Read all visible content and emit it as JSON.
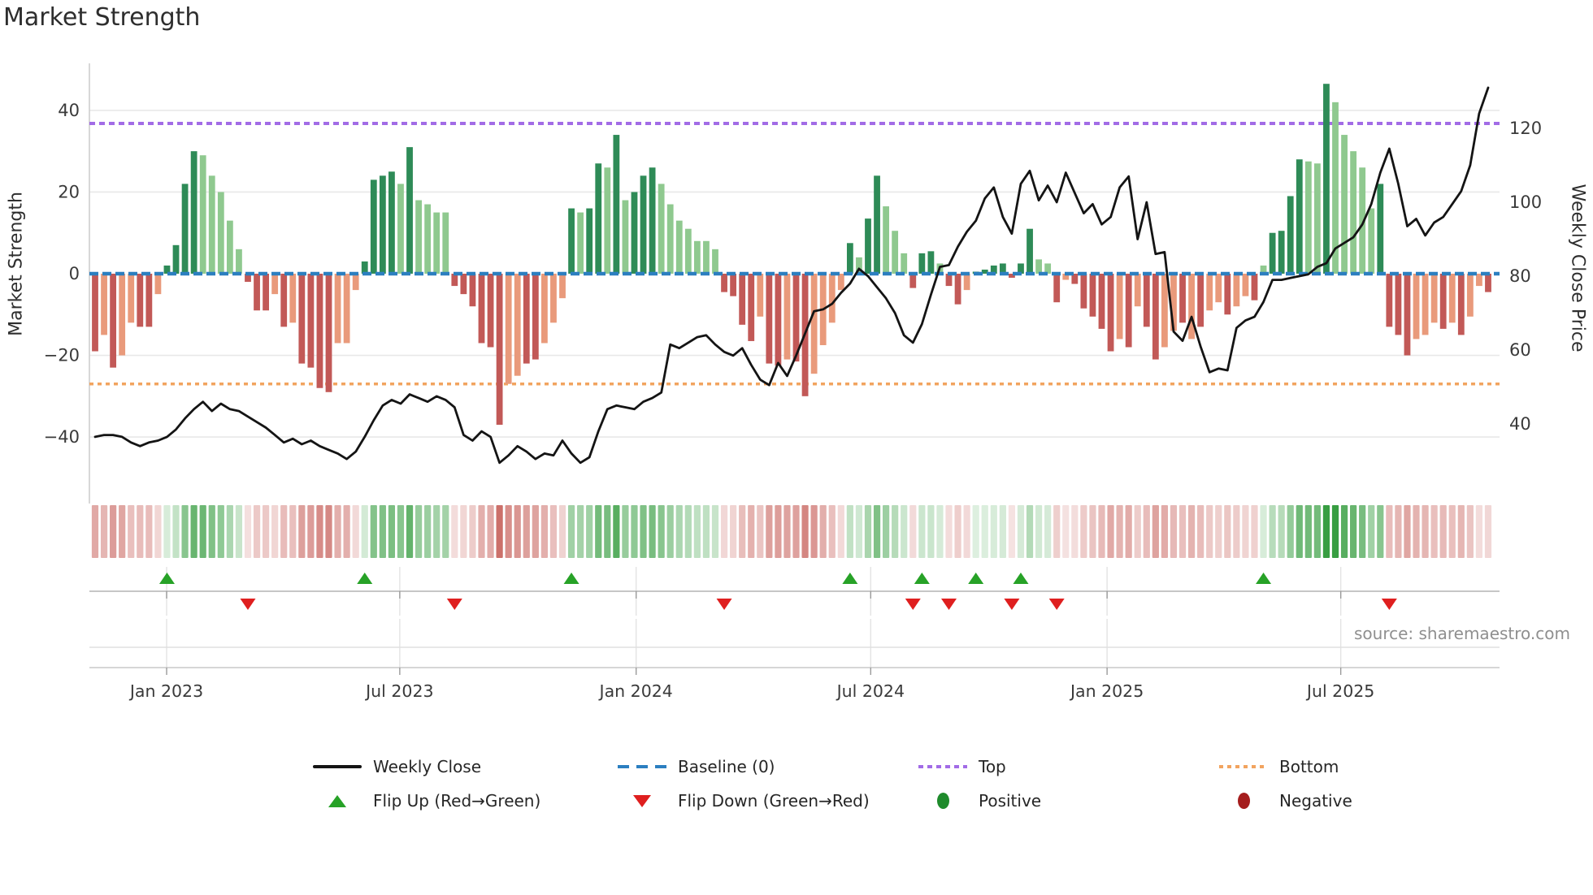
{
  "title": "Market Strength",
  "y_left_label": "Market Strength",
  "y_right_label": "Weekly Close Price",
  "source_text": "source: sharemaestro.com",
  "legend": {
    "row1": [
      {
        "name": "weekly-close",
        "label": "Weekly Close"
      },
      {
        "name": "baseline",
        "label": "Baseline (0)"
      },
      {
        "name": "top",
        "label": "Top"
      },
      {
        "name": "bottom",
        "label": "Bottom"
      }
    ],
    "row2": [
      {
        "name": "flip-up",
        "label": "Flip Up (Red→Green)"
      },
      {
        "name": "flip-down",
        "label": "Flip Down (Green→Red)"
      },
      {
        "name": "positive",
        "label": "Positive"
      },
      {
        "name": "negative",
        "label": "Negative"
      }
    ]
  },
  "colors": {
    "pos_dark": "#2e8b57",
    "pos_light": "#8fc98f",
    "neg_dark": "#c25957",
    "neg_light": "#e99a7b",
    "price_line": "#141414",
    "baseline": "#2c7fc0",
    "top_line": "#a26ce6",
    "bottom_line": "#f2a45f",
    "flip_up": "#27a227",
    "flip_down": "#df1f1f",
    "positive_marker": "#1f8b2c",
    "negative_marker": "#a51d1d",
    "grid": "#e8e8e8",
    "spine": "#cfcfcf",
    "tick_text": "#3a3a3a",
    "source_text": "#8f8f8f",
    "heat_pos_rgb": "56,158,66",
    "heat_neg_rgb": "199,96,90"
  },
  "chart_data": {
    "type": "bar+line combo with heatmap strip and flip markers",
    "weeks": 156,
    "x_range_note": "weekly data, Nov 2022 - Oct 2025",
    "x_tick_labels": [
      "Jan 2023",
      "Jul 2023",
      "Jan 2024",
      "Jul 2024",
      "Jan 2025",
      "Jul 2025"
    ],
    "x_tick_weeks": [
      7.96,
      33.9,
      60.2,
      86.3,
      112.6,
      138.6
    ],
    "left_axis": {
      "label": "Market Strength",
      "tick_values": [
        40,
        20,
        0,
        -20,
        -40
      ],
      "tick_labels": [
        "40",
        "20",
        "0",
        "−20",
        "−40"
      ]
    },
    "right_axis": {
      "label": "Weekly Close Price",
      "tick_values": [
        120,
        100,
        80,
        60,
        40
      ],
      "tick_labels": [
        "120",
        "100",
        "80",
        "60",
        "40"
      ]
    },
    "baseline_value": 0,
    "top_line_value": 36.8,
    "bottom_line_value": -27,
    "strength_bars": {
      "values": [
        -19,
        -15,
        -23,
        -20,
        -12,
        -13,
        -13,
        -5,
        2,
        7,
        22,
        30,
        29,
        24,
        20,
        13,
        6,
        -2,
        -9,
        -9,
        -5,
        -13,
        -12,
        -22,
        -23,
        -28,
        -29,
        -17,
        -17,
        -4,
        3,
        23,
        24,
        25,
        22,
        31,
        18,
        17,
        15,
        15,
        -3,
        -5,
        -8,
        -17,
        -18,
        -37,
        -27,
        -25,
        -22,
        -21,
        -17,
        -12,
        -6,
        16,
        15,
        16,
        27,
        26,
        34,
        18,
        20,
        24,
        26,
        22,
        17,
        13,
        11,
        8,
        8,
        6,
        -4.5,
        -5.5,
        -12.5,
        -16.5,
        -10.5,
        -22,
        -22.5,
        -21,
        -21.5,
        -30,
        -24.5,
        -17.5,
        -12,
        -4,
        7.5,
        4,
        13.5,
        24,
        16.5,
        10.5,
        5,
        -3.5,
        5,
        5.5,
        2.5,
        -3,
        -7.5,
        -4,
        0.5,
        1,
        2,
        2.5,
        -1,
        2.5,
        11,
        3.5,
        2.5,
        -7,
        -1.5,
        -2.5,
        -8.5,
        -10.5,
        -13.5,
        -19,
        -16,
        -18,
        -8,
        -13,
        -21,
        -18,
        -14,
        -12,
        -16,
        -13,
        -9,
        -7,
        -10,
        -8,
        -5.5,
        -6.5,
        2,
        10,
        10.5,
        19,
        28,
        27.5,
        27,
        46.5,
        42,
        34,
        30,
        26,
        16,
        22,
        -13,
        -15,
        -20,
        -16,
        -15,
        -12,
        -13.5,
        -12,
        -15,
        -10.5,
        -3,
        -4.5
      ],
      "shades": "DLDLLDDLDDDDLLLLLDDDLDLDDDDLLLDDDDLDLLLLDDDDDDLLDDLLLDLDDLDLDDDLLLLLLLDDDDLDDLDDLLLLDLDDLLLDDDLDDLDDDDDDDLLDLDDDDDLDLDDLLDLDLLDLLDLDDDDLLDLLLLLDDDDLLLDLDLLD"
    },
    "weekly_close": [
      36.5,
      37,
      37,
      36.5,
      35,
      34,
      35,
      35.5,
      36.5,
      38.5,
      41.5,
      44,
      46,
      43.5,
      45.5,
      44,
      43.5,
      42,
      40.5,
      39,
      37,
      35,
      36,
      34.5,
      35.5,
      34,
      33,
      32,
      30.5,
      32.5,
      36.5,
      41,
      45,
      46.5,
      45.5,
      48,
      47,
      46,
      47.5,
      46.5,
      44.5,
      37,
      35.5,
      38,
      36.5,
      29.5,
      31.5,
      34,
      32.5,
      30.5,
      32,
      31.5,
      35.5,
      32,
      29.5,
      31,
      38,
      44,
      45,
      44.5,
      44,
      46,
      47,
      48.5,
      61.5,
      60.5,
      62,
      63.5,
      64,
      61.5,
      59.5,
      58.5,
      60.5,
      56,
      52,
      50.5,
      56.5,
      53,
      58.5,
      64.5,
      70.5,
      71,
      72.5,
      75.5,
      78,
      82,
      80,
      77,
      74,
      70,
      64,
      62,
      67,
      75,
      82.5,
      83,
      88,
      92,
      95,
      101,
      104,
      96,
      91.5,
      105,
      108.5,
      100.5,
      104.5,
      100,
      108,
      102.5,
      97,
      99.5,
      94,
      96,
      104,
      107,
      90,
      100,
      86,
      86.5,
      65,
      62.5,
      69,
      61,
      54,
      55,
      54.5,
      66,
      68,
      69,
      73,
      79,
      79,
      79.5,
      80,
      80.5,
      82.5,
      83.5,
      87.5,
      89,
      90.5,
      94,
      99.5,
      108,
      114.5,
      105,
      93.5,
      95.5,
      91,
      94.5,
      96,
      99.5,
      103,
      110,
      124,
      131
    ],
    "flip_up_weeks": [
      8,
      30,
      53,
      84,
      92,
      98,
      103,
      130
    ],
    "flip_down_weeks": [
      17,
      40,
      70,
      91,
      95,
      102,
      107,
      144
    ],
    "heatmap_note": "one cell per week, red/green intensity proportional to |strength|"
  }
}
